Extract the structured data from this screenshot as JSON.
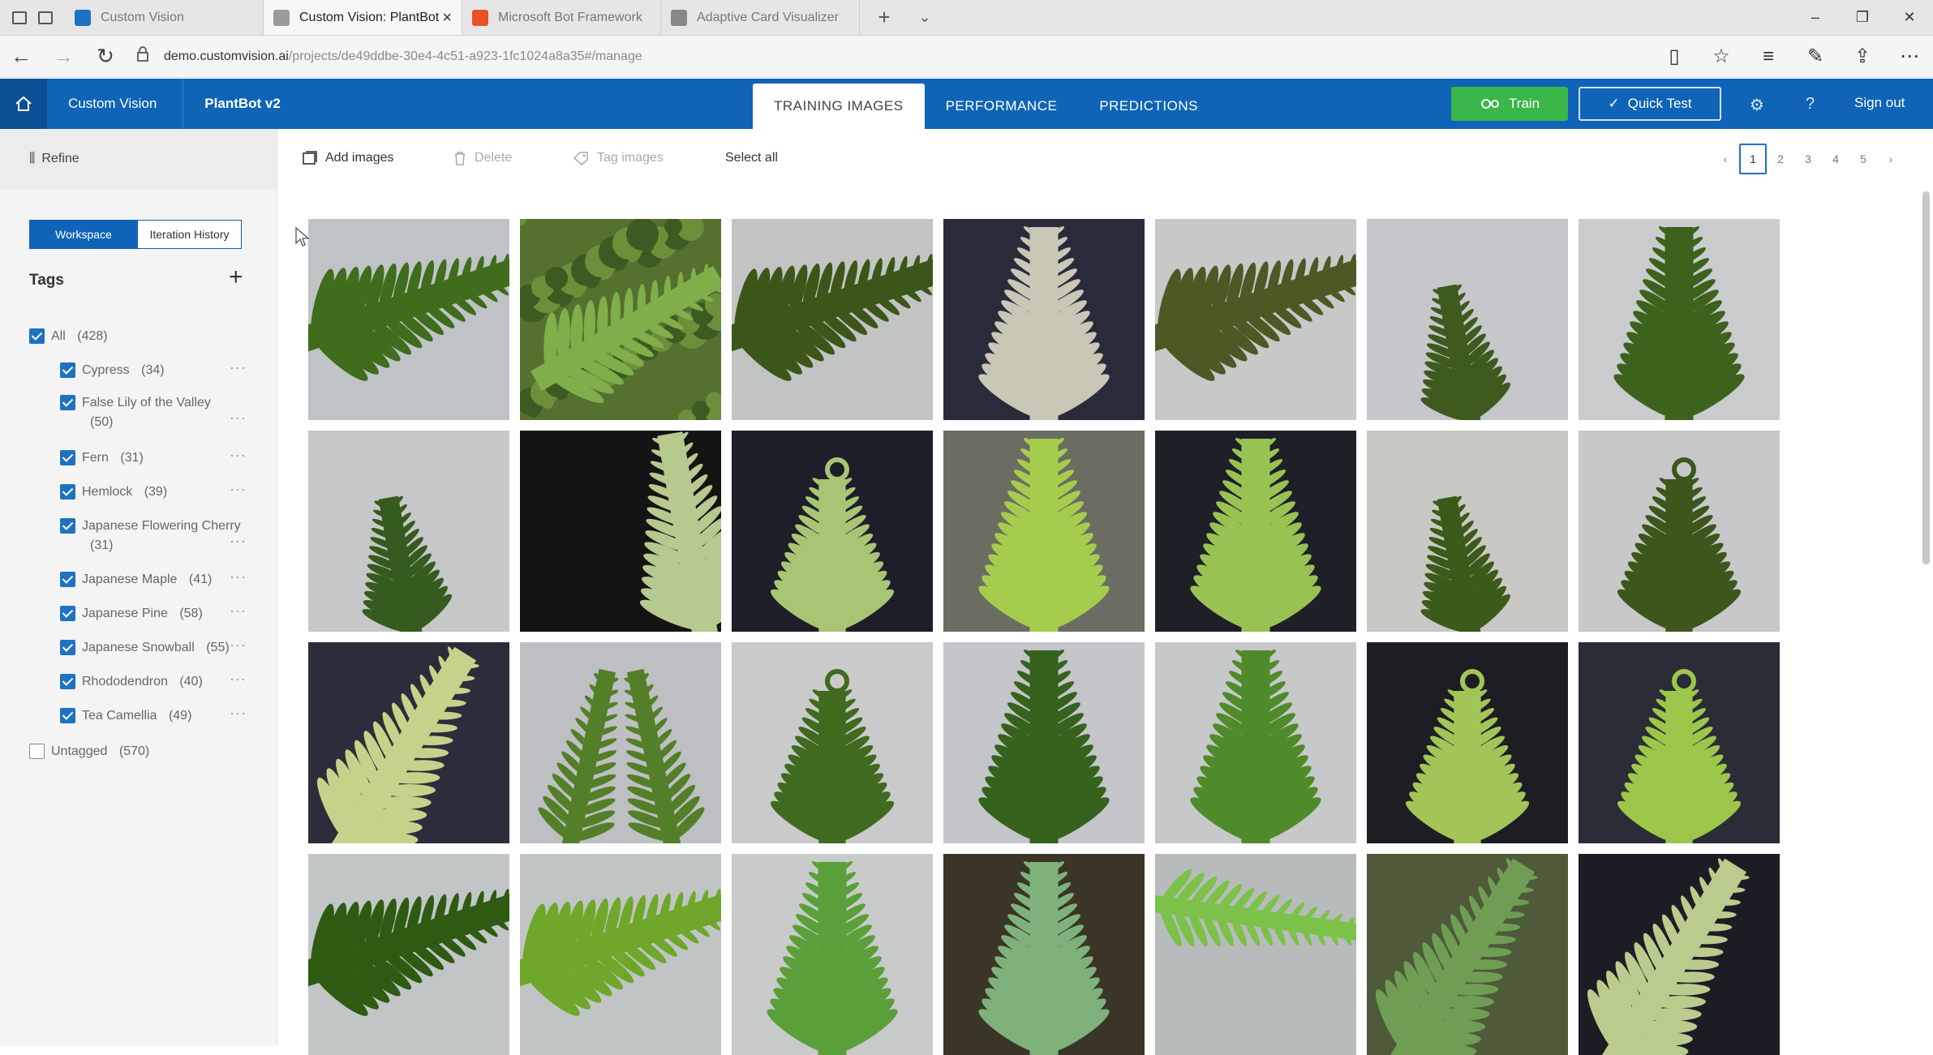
{
  "browser": {
    "tabs": [
      {
        "title": "Custom Vision",
        "active": false,
        "favicon_color": "#1f72c2"
      },
      {
        "title": "Custom Vision: PlantBot",
        "active": true,
        "favicon_color": "#9a9a9a"
      },
      {
        "title": "Microsoft Bot Framework",
        "active": false,
        "favicon_color": "#e8512a"
      },
      {
        "title": "Adaptive Card Visualizer",
        "active": false,
        "favicon_color": "#888888"
      }
    ],
    "url_host": "demo.customvision.ai",
    "url_path": "/projects/de49ddbe-30e4-4c51-a923-1fc1024a8a35#/manage"
  },
  "app": {
    "breadcrumb": [
      "Custom Vision",
      "PlantBot v2"
    ],
    "nav_tabs": [
      {
        "label": "TRAINING IMAGES",
        "active": true
      },
      {
        "label": "PERFORMANCE",
        "active": false
      },
      {
        "label": "PREDICTIONS",
        "active": false
      }
    ],
    "train_label": "Train",
    "quick_test_label": "Quick Test",
    "sign_out_label": "Sign out",
    "brand_color": "#0f64b8",
    "train_color": "#3bb64a"
  },
  "sidebar": {
    "refine_label": "Refine",
    "segment": {
      "workspace": "Workspace",
      "iteration_history": "Iteration History"
    },
    "tags_heading": "Tags",
    "tags": [
      {
        "name": "All",
        "count": "(428)",
        "checked": true
      },
      {
        "name": "Cypress",
        "count": "(34)",
        "checked": true
      },
      {
        "name": "False Lily of the Valley",
        "count": "(50)",
        "checked": true
      },
      {
        "name": "Fern",
        "count": "(31)",
        "checked": true
      },
      {
        "name": "Hemlock",
        "count": "(39)",
        "checked": true
      },
      {
        "name": "Japanese Flowering Cherry",
        "count": "(31)",
        "checked": true
      },
      {
        "name": "Japanese Maple",
        "count": "(41)",
        "checked": true
      },
      {
        "name": "Japanese Pine",
        "count": "(58)",
        "checked": true
      },
      {
        "name": "Japanese Snowball",
        "count": "(55)",
        "checked": true
      },
      {
        "name": "Rhododendron",
        "count": "(40)",
        "checked": true
      },
      {
        "name": "Tea Camellia",
        "count": "(49)",
        "checked": true
      },
      {
        "name": "Untagged",
        "count": "(570)",
        "checked": false
      }
    ]
  },
  "toolbar": {
    "add_images": "Add images",
    "delete": "Delete",
    "tag_images": "Tag images",
    "select_all": "Select all"
  },
  "pagination": {
    "prev": "‹",
    "pages": [
      "1",
      "2",
      "3",
      "4",
      "5"
    ],
    "current": "1",
    "next": "›"
  },
  "images": [
    {
      "bg": "#bfc3c6",
      "leaf": "#3f6d1c",
      "kind": "frond-h"
    },
    {
      "bg": "#55702f",
      "leaf": "#7fae4a",
      "kind": "moss"
    },
    {
      "bg": "#c2c4c3",
      "leaf": "#3c5619",
      "kind": "frond-h"
    },
    {
      "bg": "#2a2b3a",
      "leaf": "#c9c7b5",
      "kind": "frond-v"
    },
    {
      "bg": "#c7c8c8",
      "leaf": "#4b5a25",
      "kind": "frond-h"
    },
    {
      "bg": "#c5c7ca",
      "leaf": "#3e5a1e",
      "kind": "frond-small"
    },
    {
      "bg": "#c9cbcd",
      "leaf": "#3c621c",
      "kind": "frond-v"
    },
    {
      "bg": "#c6c7c9",
      "leaf": "#355b1e",
      "kind": "frond-small"
    },
    {
      "bg": "#141414",
      "leaf": "#b6c98e",
      "kind": "frond-edge"
    },
    {
      "bg": "#1c1e29",
      "leaf": "#a9c473",
      "kind": "frond-curl"
    },
    {
      "bg": "#6b6d62",
      "leaf": "#a6cc4e",
      "kind": "frond-v"
    },
    {
      "bg": "#1e2028",
      "leaf": "#98c352",
      "kind": "frond-v"
    },
    {
      "bg": "#c9c8c4",
      "leaf": "#3c5a1a",
      "kind": "frond-small"
    },
    {
      "bg": "#c7c8c9",
      "leaf": "#3d561c",
      "kind": "frond-curl"
    },
    {
      "bg": "#2c2d3b",
      "leaf": "#c8d18a",
      "kind": "frond-diag"
    },
    {
      "bg": "#bdbfc2",
      "leaf": "#547f29",
      "kind": "frond-arch"
    },
    {
      "bg": "#c9cac9",
      "leaf": "#3f6a1f",
      "kind": "frond-curl"
    },
    {
      "bg": "#c3c5c8",
      "leaf": "#35621d",
      "kind": "frond-v"
    },
    {
      "bg": "#c6c8c9",
      "leaf": "#4f8b2a",
      "kind": "frond-v"
    },
    {
      "bg": "#1d1e24",
      "leaf": "#a3c557",
      "kind": "frond-curl"
    },
    {
      "bg": "#2a2c37",
      "leaf": "#9ec64a",
      "kind": "frond-curl"
    },
    {
      "bg": "#c2c5c6",
      "leaf": "#2f5a12",
      "kind": "frond-h"
    },
    {
      "bg": "#c0c4c4",
      "leaf": "#6fa72a",
      "kind": "frond-h"
    },
    {
      "bg": "#c8cbc9",
      "leaf": "#5b9f3a",
      "kind": "frond-v"
    },
    {
      "bg": "#3a3526",
      "leaf": "#7fb27a",
      "kind": "frond-v"
    },
    {
      "bg": "#b8bbbc",
      "leaf": "#7cc24a",
      "kind": "frond-hband"
    },
    {
      "bg": "#4e5a3a",
      "leaf": "#6f9d54",
      "kind": "frond-diag"
    },
    {
      "bg": "#1c1d24",
      "leaf": "#b9cc8e",
      "kind": "frond-diag"
    }
  ]
}
